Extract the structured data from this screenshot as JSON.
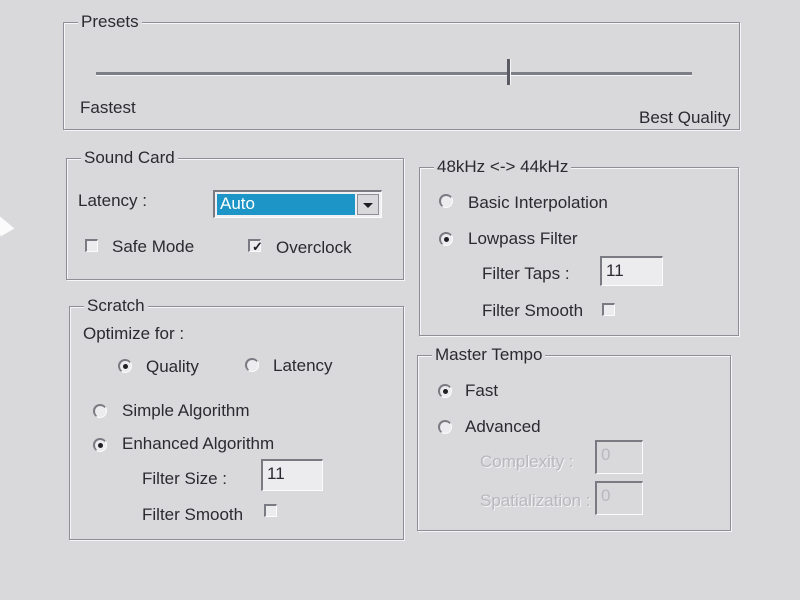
{
  "presets": {
    "legend": "Presets",
    "min_label": "Fastest",
    "max_label": "Best Quality",
    "slider_level": 0.69
  },
  "sound_card": {
    "legend": "Sound Card",
    "latency_label": "Latency :",
    "latency_value": "Auto",
    "safe_mode_label": "Safe Mode",
    "safe_mode_checked": false,
    "overclock_label": "Overclock",
    "overclock_checked": true
  },
  "resample": {
    "legend": "48kHz <-> 44kHz",
    "basic_label": "Basic Interpolation",
    "lowpass_label": "Lowpass Filter",
    "selected": "Lowpass Filter",
    "filter_taps_label": "Filter Taps :",
    "filter_taps_value": "11",
    "filter_smooth_label": "Filter Smooth",
    "filter_smooth_checked": false
  },
  "scratch": {
    "legend": "Scratch",
    "optimize_label": "Optimize for :",
    "quality_label": "Quality",
    "latency_label": "Latency",
    "optimize_selected": "Quality",
    "simple_label": "Simple Algorithm",
    "enhanced_label": "Enhanced Algorithm",
    "algorithm_selected": "Enhanced Algorithm",
    "filter_size_label": "Filter Size :",
    "filter_size_value": "11",
    "filter_smooth_label": "Filter Smooth",
    "filter_smooth_checked": false
  },
  "master_tempo": {
    "legend": "Master Tempo",
    "fast_label": "Fast",
    "advanced_label": "Advanced",
    "selected": "Fast",
    "complexity_label": "Complexity :",
    "complexity_value": "0",
    "spatialization_label": "Spatialization :",
    "spatialization_value": "0"
  }
}
